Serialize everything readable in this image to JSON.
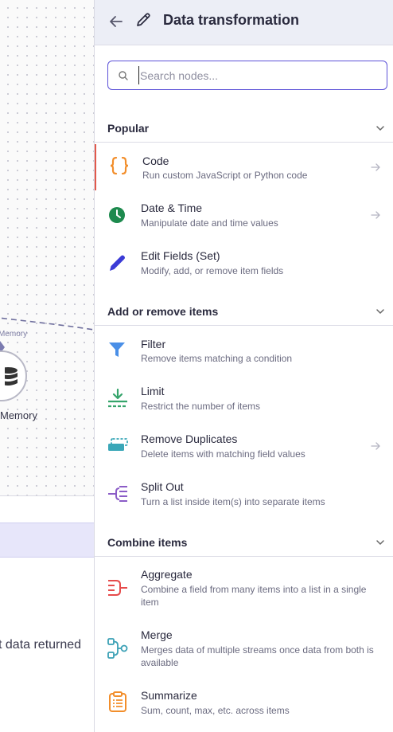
{
  "canvas": {
    "edge_label": "Memory",
    "memory_node_label": "Memory",
    "no_data_text": "t data returned"
  },
  "header": {
    "title": "Data transformation",
    "back_icon": "arrow-left-icon",
    "edit_icon": "pencil-icon"
  },
  "search": {
    "placeholder": "Search nodes...",
    "value": ""
  },
  "sections": {
    "popular": {
      "title": "Popular",
      "items": [
        {
          "name": "Code",
          "desc": "Run custom JavaScript or Python code",
          "icon": "code-braces-icon",
          "color": "#f28e2b"
        },
        {
          "name": "Date & Time",
          "desc": "Manipulate date and time values",
          "icon": "clock-icon",
          "color": "#1d8a4e"
        },
        {
          "name": "Edit Fields (Set)",
          "desc": "Modify, add, or remove item fields",
          "icon": "pen-icon",
          "color": "#3b3bd6"
        }
      ]
    },
    "add_remove": {
      "title": "Add or remove items",
      "items": [
        {
          "name": "Filter",
          "desc": "Remove items matching a condition",
          "icon": "filter-icon",
          "color": "#4a8fe7"
        },
        {
          "name": "Limit",
          "desc": "Restrict the number of items",
          "icon": "limit-icon",
          "color": "#35a46b"
        },
        {
          "name": "Remove Duplicates",
          "desc": "Delete items with matching field values",
          "icon": "remove-duplicates-icon",
          "color": "#3aa7b8"
        },
        {
          "name": "Split Out",
          "desc": "Turn a list inside item(s) into separate items",
          "icon": "split-out-icon",
          "color": "#8b5cc7"
        }
      ]
    },
    "combine": {
      "title": "Combine items",
      "items": [
        {
          "name": "Aggregate",
          "desc": "Combine a field from many items into a list in a single item",
          "icon": "aggregate-icon",
          "color": "#e64b4b"
        },
        {
          "name": "Merge",
          "desc": "Merges data of multiple streams once data from both is available",
          "icon": "merge-icon",
          "color": "#3aa0b5"
        },
        {
          "name": "Summarize",
          "desc": "Sum, count, max, etc. across items",
          "icon": "clipboard-list-icon",
          "color": "#f28e2b"
        }
      ]
    }
  }
}
